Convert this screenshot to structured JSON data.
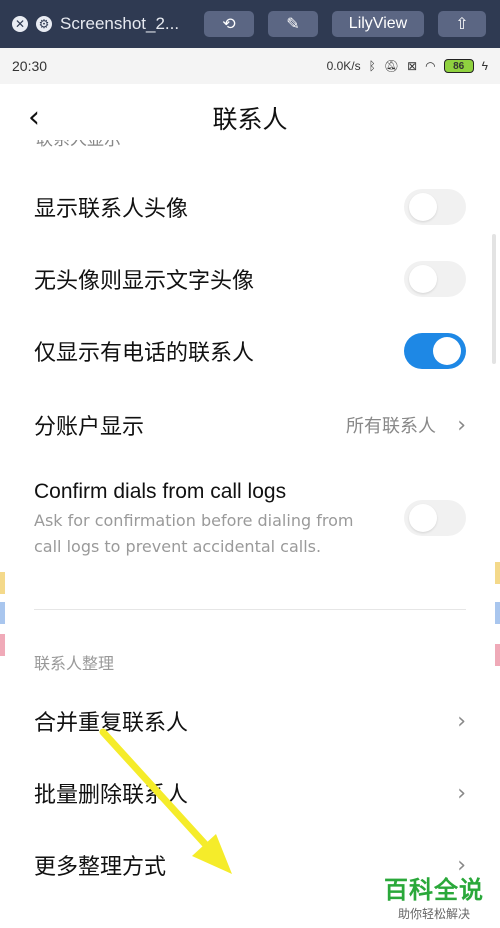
{
  "viewer": {
    "title": "Screenshot_2...",
    "lily_label": "LilyView"
  },
  "status": {
    "time": "20:30",
    "speed": "0.0K/s",
    "battery": "86"
  },
  "header": {
    "title": "联系人"
  },
  "sections": {
    "display_cut": "联系人显示",
    "org_title": "联系人整理"
  },
  "rows": {
    "show_avatar": "显示联系人头像",
    "text_avatar": "无头像则显示文字头像",
    "phone_only": "仅显示有电话的联系人",
    "account_display": "分账户显示",
    "account_value": "所有联系人",
    "confirm_title": "Confirm dials from call logs",
    "confirm_desc": "Ask for confirmation before dialing from call logs to prevent accidental calls.",
    "merge": "合并重复联系人",
    "batch_delete": "批量删除联系人",
    "more": "更多整理方式"
  },
  "toggles": {
    "show_avatar": false,
    "text_avatar": false,
    "phone_only": true,
    "confirm_dials": false
  },
  "watermark": {
    "main": "百科全说",
    "sub": "助你轻松解决"
  },
  "colors": {
    "accent": "#1e88e5",
    "toolbar": "#2f3a52",
    "arrow": "#f5ec2a",
    "watermark": "#2aa83a"
  }
}
